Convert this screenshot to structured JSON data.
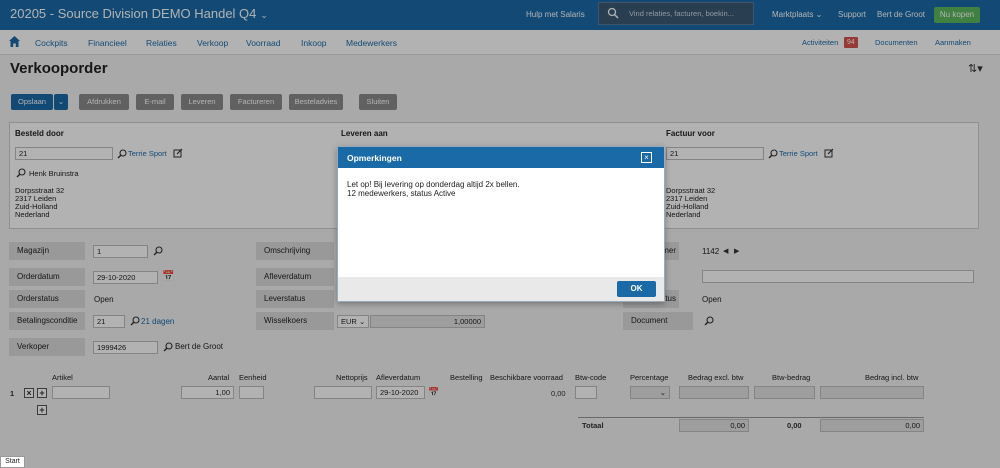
{
  "app": {
    "title": "20205 - Source Division DEMO Handel Q4",
    "help": "Hulp met Salaris",
    "search_placeholder": "Vind relaties, facturen, boekin...",
    "marketplace": "Marktplaats",
    "support": "Support",
    "user": "Bert de Groot",
    "buy_now": "Nu kopen"
  },
  "nav": {
    "items": [
      "Cockpits",
      "Financieel",
      "Relaties",
      "Verkoop",
      "Voorraad",
      "Inkoop",
      "Medewerkers"
    ],
    "activities": "Activiteiten",
    "activities_count": "94",
    "documents": "Documenten",
    "create": "Aanmaken"
  },
  "page": {
    "title": "Verkooporder"
  },
  "toolbar": {
    "save": "Opslaan",
    "print": "Afdrukken",
    "email": "E-mail",
    "deliver": "Leveren",
    "invoice": "Factureren",
    "order_advice": "Besteladvies",
    "close": "Sluiten"
  },
  "addresses": {
    "ordered_by": {
      "label": "Besteld door",
      "code": "21",
      "name": "Terrie Sport",
      "contact": "Henk Bruinstra",
      "lines": [
        "Dorpsstraat 32",
        "2317 Leiden",
        "Zuid-Holland",
        "Nederland"
      ]
    },
    "deliver_to": {
      "label": "Leveren aan"
    },
    "invoice_to": {
      "label": "Factuur voor",
      "code": "21",
      "name": "Terrie Sport",
      "contact": "Henk Bruinstra",
      "lines": [
        "Dorpsstraat 32",
        "2317 Leiden",
        "Zuid-Holland",
        "Nederland"
      ]
    }
  },
  "form": {
    "warehouse_label": "Magazijn",
    "warehouse_value": "1",
    "order_date_label": "Orderdatum",
    "order_date_value": "29-10-2020",
    "order_status_label": "Orderstatus",
    "order_status_value": "Open",
    "payment_label": "Betalingsconditie",
    "payment_value": "21",
    "payment_link": "21 dagen",
    "seller_label": "Verkoper",
    "seller_code": "1999426",
    "seller_name": "Bert de Groot",
    "description_label": "Omschrijving",
    "delivery_date_label": "Afleverdatum",
    "delivery_status_label": "Leverstatus",
    "exchange_label": "Wisselkoers",
    "currency": "EUR",
    "exchange_rate": "1,00000",
    "number_label_partial": "mer",
    "number_value": "1142",
    "status_label_partial": "tus",
    "status_value": "Open",
    "document_label": "Document"
  },
  "grid": {
    "headers": {
      "article": "Artikel",
      "quantity": "Aantal",
      "unit": "Eenheid",
      "net_price": "Nettoprijs",
      "delivery_date": "Afleverdatum",
      "order": "Bestelling",
      "available_stock": "Beschikbare voorraad",
      "vat_code": "Btw-code",
      "percentage": "Percentage",
      "amount_excl": "Bedrag excl. btw",
      "vat_amount": "Btw-bedrag",
      "amount_incl": "Bedrag incl. btw"
    },
    "row": {
      "index": "1",
      "quantity": "1,00",
      "delivery_date": "29-10-2020",
      "available_stock": "0,00"
    },
    "total_label": "Totaal",
    "total_excl": "0,00",
    "total_vat": "0,00",
    "total_incl": "0,00"
  },
  "modal": {
    "title": "Opmerkingen",
    "line1": "Let op! Bij levering op donderdag altijd 2x bellen.",
    "line2": "12 medewerkers, status Active",
    "ok": "OK"
  },
  "taskbar": {
    "start": "Start"
  }
}
